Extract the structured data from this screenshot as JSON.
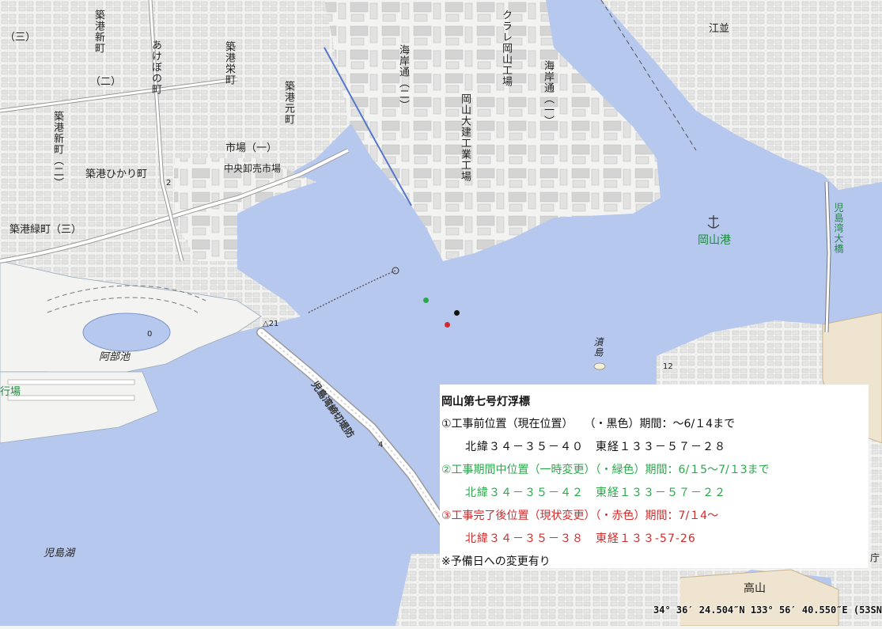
{
  "map": {
    "colors": {
      "water": "#b7c8ee",
      "land": "#f3f3f1",
      "block": "#e3e3e3",
      "building": "#cfcfcf",
      "road": "#ffffff",
      "road_edge": "#9a9a9a",
      "green_text": "#1a8a3c"
    },
    "labels": {
      "chikko_shin": "築港新町",
      "akebono": "あけぼの町",
      "chikko_sakae": "築港栄町",
      "chikko_moto": "築港元町",
      "ichiba": "市場（一）",
      "chuo_oroshi": "中央卸売市場",
      "hikari": "築港ひかり町",
      "midori": "築港緑町（三）",
      "shin_ni": "築港新町（二）",
      "san": "（三）",
      "ni": "（二）",
      "kaigan_ni": "海岸通（二）",
      "kaigan_ichi": "海岸通（一）",
      "kuraray": "クラレ岡山工場",
      "okayama_daiken": "岡山大建工業工場",
      "enami": "江並",
      "okayama_port": "岡山港",
      "kojima_bridge": "児島湾大橋",
      "kojima_bay_dam": "児島湾締切堤防",
      "abe_ike": "阿部池",
      "kojima_ko": "児島湖",
      "kiyoshima": "濆島",
      "gyojo": "行場",
      "takayama": "高山",
      "elev_21": "△21",
      "elev_12": "12",
      "elev_0": "0",
      "route_2": "2",
      "route_4": "4",
      "chou": "庁"
    },
    "buoy_positions": {
      "before": "black",
      "during": "green",
      "after": "red"
    }
  },
  "info": {
    "title": "岡山第七号灯浮標",
    "l1": "①工事前位置（現在位置）　　（・黒色）期間：～6/１4まで",
    "l1_coords": "北緯３４－３５－４０　東経１３３－５７－２８",
    "l2": "②工事期間中位置（一時変更）（・緑色）期間：6/１5～7/１3まで",
    "l2_coords": "北緯３４－３５－４２　東経１３３－５７－２２",
    "l3": "③工事完了後位置（現状変更）（・赤色）期間：7/１4～",
    "l3_coords": "北緯３４－３５－３８　東経１３３-57-26",
    "note": "※予備日への変更有り",
    "colors": {
      "black": "#111111",
      "green": "#2aa84a",
      "red": "#d12a2a"
    }
  },
  "coords": "34° 36′ 24.504″N 133° 56′ 40.550″E (53SN"
}
